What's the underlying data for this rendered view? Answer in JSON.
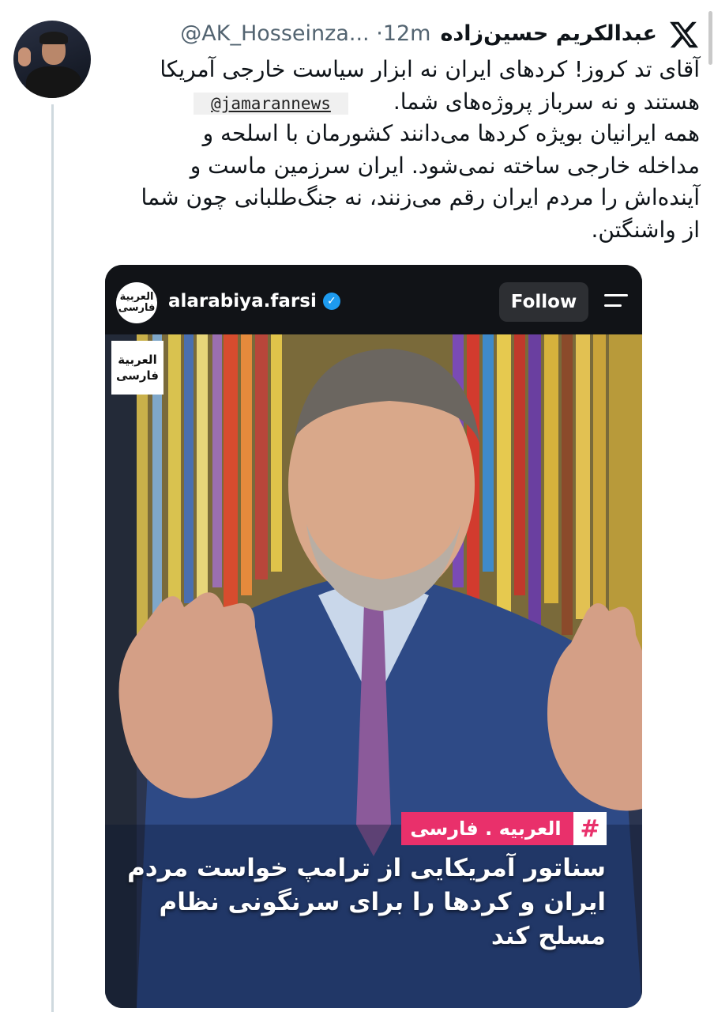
{
  "tweet": {
    "display_name": "عبدالکریم حسین‌زاده",
    "handle": "@AK_Hosseinza...",
    "separator": "·",
    "time": "12m",
    "text": "آقای تد کروز! کردهای ایران نه ابزار سیاست خارجی آمریکا\nهستند و نه سرباز پروژه‌های شما.\nهمه ایرانیان بویژه کردها می‌دانند کشورمان با اسلحه و\nمداخله خارجی ساخته نمی‌شود. ایران سرزمین ماست و\nآینده‌اش را مردم ایران رقم می‌زنند، نه جنگ‌طلبانی چون شما\nاز واشنگتن.",
    "mention_tag": "@jamarannews"
  },
  "instagram_card": {
    "account": "alarabiya.farsi",
    "logo_line1": "العربية",
    "logo_line2": "فارسی",
    "follow_label": "Follow",
    "watermark_line1": "العربية",
    "watermark_line2": "فارسی",
    "tag_label": "العربیه . فارسی",
    "tag_hash": "#",
    "headline": "سناتور آمریکایی از ترامپ خواست مردم\nایران و کردها را برای سرنگونی نظام\nمسلح کند"
  },
  "colors": {
    "accent_pink": "#e9306b",
    "verified_blue": "#1d9bf0",
    "handle_gray": "#536471"
  },
  "icons": [
    "x-logo-icon",
    "verified-badge-icon",
    "menu-icon"
  ]
}
